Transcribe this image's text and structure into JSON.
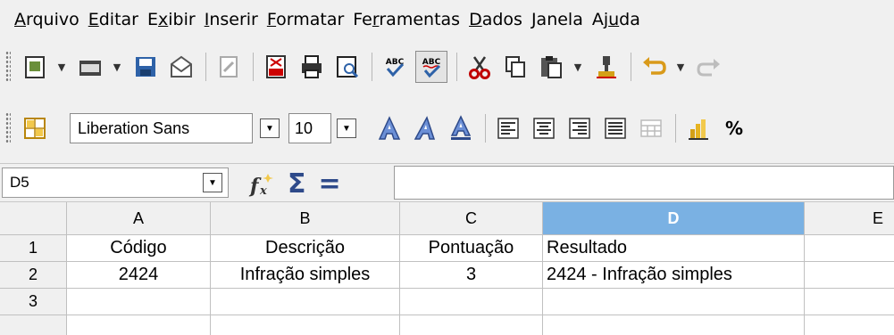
{
  "menu": [
    {
      "pre": "",
      "u": "A",
      "post": "rquivo"
    },
    {
      "pre": "",
      "u": "E",
      "post": "ditar"
    },
    {
      "pre": "E",
      "u": "x",
      "post": "ibir"
    },
    {
      "pre": "",
      "u": "I",
      "post": "nserir"
    },
    {
      "pre": "",
      "u": "F",
      "post": "ormatar"
    },
    {
      "pre": "Fe",
      "u": "r",
      "post": "ramentas"
    },
    {
      "pre": "",
      "u": "D",
      "post": "ados"
    },
    {
      "pre": "",
      "u": "J",
      "post": "anela"
    },
    {
      "pre": "Aj",
      "u": "u",
      "post": "da"
    }
  ],
  "toolbar": {
    "font_name": "Liberation Sans",
    "font_size": "10",
    "percent": "%",
    "spell1": "ABC",
    "spell2": "ABC"
  },
  "formula": {
    "cell_ref": "D5",
    "sum_symbol": "Σ",
    "equals_symbol": "="
  },
  "sheet": {
    "columns": [
      "A",
      "B",
      "C",
      "D",
      "E"
    ],
    "active_column": "D",
    "rows": [
      {
        "num": "1",
        "cells": [
          "Código",
          "Descrição",
          "Pontuação",
          "Resultado",
          ""
        ]
      },
      {
        "num": "2",
        "cells": [
          "2424",
          "Infração simples",
          "3",
          "2424 - Infração simples",
          ""
        ]
      },
      {
        "num": "3",
        "cells": [
          "",
          "",
          "",
          "",
          ""
        ]
      },
      {
        "num": "",
        "cells": [
          "",
          "",
          "",
          "",
          ""
        ]
      }
    ]
  },
  "colors": {
    "accent_header": "#7ab1e3",
    "cut_icon": "#c00000",
    "undo_icon": "#d99a1a"
  }
}
